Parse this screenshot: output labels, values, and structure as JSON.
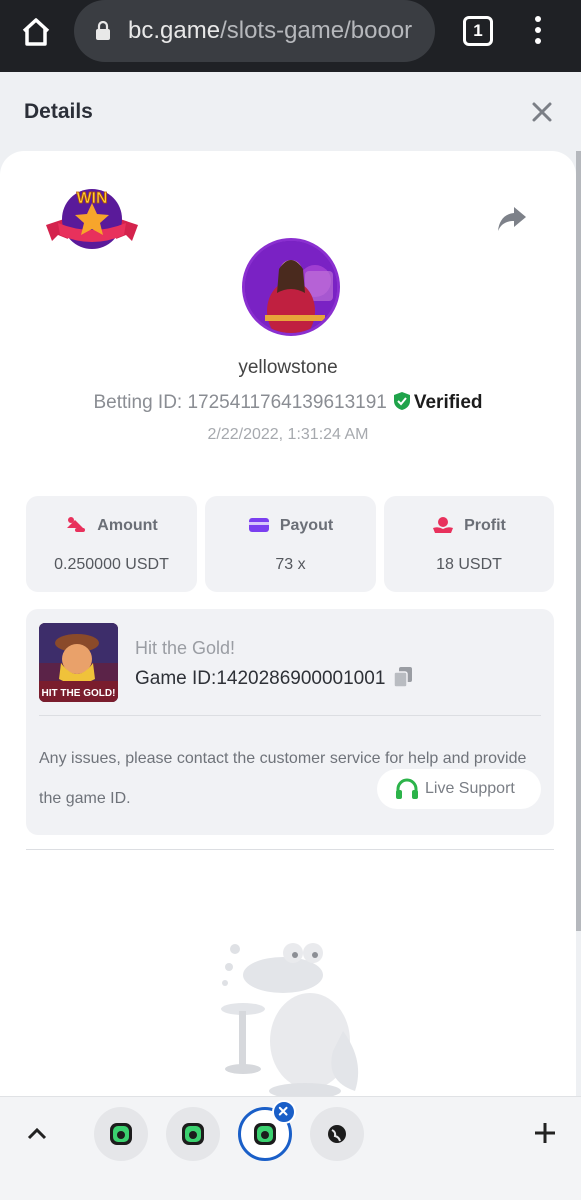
{
  "browser": {
    "url_domain": "bc.game",
    "url_path": "/slots-game/booor",
    "tab_count": "1"
  },
  "header": {
    "title": "Details"
  },
  "bet": {
    "username": "yellowstone",
    "betting_id_label": "Betting ID: ",
    "betting_id": "1725411764139613191",
    "verified_label": "Verified",
    "time": "2/22/2022, 1:31:24 AM"
  },
  "stats": {
    "amount_label": "Amount",
    "amount_value": "0.250000 USDT",
    "payout_label": "Payout",
    "payout_value": "73 x",
    "profit_label": "Profit",
    "profit_value": "18 USDT"
  },
  "game": {
    "name": "Hit the Gold!",
    "id_label": "Game ID:",
    "id_value": "1420286900001001",
    "thumb_caption": "HIT THE GOLD!",
    "issue_text": "Any issues, please contact the customer service for help and provide the game ID.",
    "live_support_label": "Live Support"
  },
  "badge": {
    "win_text": "WIN"
  },
  "colors": {
    "accent_purple": "#8a2fd0",
    "verified_green": "#1fa34a",
    "tab_active_blue": "#1a5fc8",
    "support_green": "#2cb34a"
  }
}
